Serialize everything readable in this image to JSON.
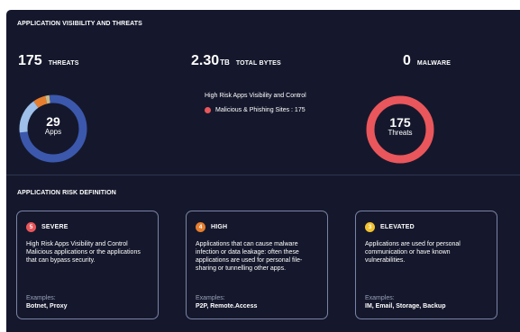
{
  "visibility": {
    "title": "APPLICATION VISIBILITY AND THREATS",
    "threats_count": "175",
    "threats_label": "THREATS",
    "bytes_value": "2.30",
    "bytes_unit": "TB",
    "bytes_label": "TOTAL BYTES",
    "malware_count": "0",
    "malware_label": "MALWARE",
    "apps_donut": {
      "value": "29",
      "label": "Apps",
      "segments": [
        {
          "color": "#3b58ad",
          "fraction": 0.73
        },
        {
          "color": "#9ec0ea",
          "fraction": 0.17
        },
        {
          "color": "#e57e2e",
          "fraction": 0.06
        },
        {
          "color": "#c8b98a",
          "fraction": 0.02
        },
        {
          "color": "#3b58ad",
          "fraction": 0.02
        }
      ]
    },
    "high_risk": {
      "title": "High Risk Apps Visibility and Control",
      "item": "Malicious & Phishing Sites : 175",
      "dot_color": "#e9565b"
    },
    "threats_donut": {
      "value": "175",
      "label": "Threats",
      "color": "#e9565b"
    }
  },
  "risk": {
    "title": "APPLICATION RISK DEFINITION",
    "cards": [
      {
        "badge": "5",
        "badge_color": "#e9565b",
        "title": "SEVERE",
        "description": "High Risk Apps Visibility and Control Malicious applications or the applications that can bypass security.",
        "examples_label": "Examples:",
        "examples": "Botnet, Proxy"
      },
      {
        "badge": "4",
        "badge_color": "#e57e2e",
        "title": "HIGH",
        "description": "Applications that can cause malware infection or data leakage: often these applications are used for personal file-sharing or tunnelling other apps.",
        "examples_label": "Examples:",
        "examples": "P2P, Remote.Access"
      },
      {
        "badge": "3",
        "badge_color": "#f2c230",
        "title": "ELEVATED",
        "description": "Applications are used for personal communication or have known vulnerabilities.",
        "examples_label": "Examples:",
        "examples": "IM, Email, Storage, Backup"
      }
    ]
  }
}
